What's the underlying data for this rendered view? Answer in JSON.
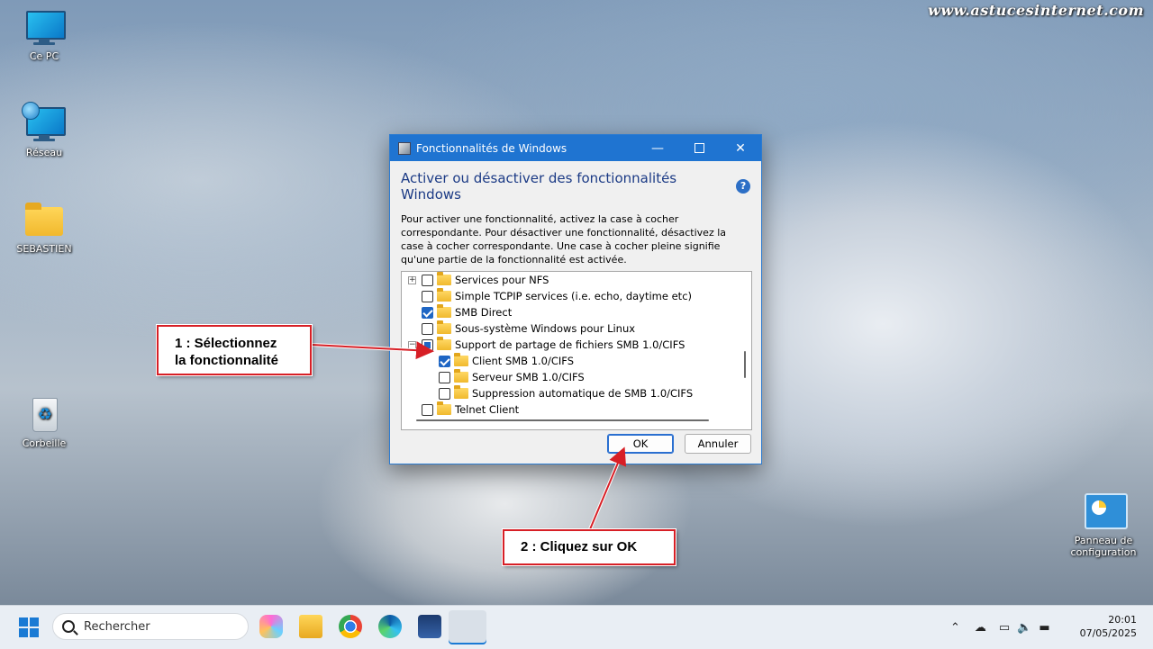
{
  "watermark": "www.astucesinternet.com",
  "desktop": {
    "icons": [
      {
        "label": "Ce PC"
      },
      {
        "label": "Réseau"
      },
      {
        "label": "SEBASTIEN"
      },
      {
        "label": "Corbeille"
      },
      {
        "label": "Panneau de configuration"
      }
    ]
  },
  "dialog": {
    "title": "Fonctionnalités de Windows",
    "heading": "Activer ou désactiver des fonctionnalités Windows",
    "help": "?",
    "description": "Pour activer une fonctionnalité, activez la case à cocher correspondante. Pour désactiver une fonctionnalité, désactivez la case à cocher correspondante. Une case à cocher pleine signifie qu'une partie de la fonctionnalité est activée.",
    "features": [
      {
        "label": "Services pour NFS",
        "state": "unchecked",
        "expander": "+"
      },
      {
        "label": "Simple TCPIP services (i.e. echo, daytime etc)",
        "state": "unchecked"
      },
      {
        "label": "SMB Direct",
        "state": "checked"
      },
      {
        "label": "Sous-système Windows pour Linux",
        "state": "unchecked"
      },
      {
        "label": "Support de partage de fichiers SMB 1.0/CIFS",
        "state": "partial",
        "expander": "−"
      },
      {
        "label": "Client SMB 1.0/CIFS",
        "state": "checked",
        "child": true
      },
      {
        "label": "Serveur SMB 1.0/CIFS",
        "state": "unchecked",
        "child": true
      },
      {
        "label": "Suppression automatique de SMB 1.0/CIFS",
        "state": "unchecked",
        "child": true
      },
      {
        "label": "Telnet Client",
        "state": "unchecked"
      }
    ],
    "ok_label": "OK",
    "cancel_label": "Annuler"
  },
  "callouts": {
    "step1_line1": "1 : Sélectionnez",
    "step1_line2": "la fonctionnalité",
    "step2": "2 : Cliquez sur OK"
  },
  "taskbar": {
    "search_placeholder": "Rechercher",
    "time": "20:01",
    "date": "07/05/2025"
  }
}
